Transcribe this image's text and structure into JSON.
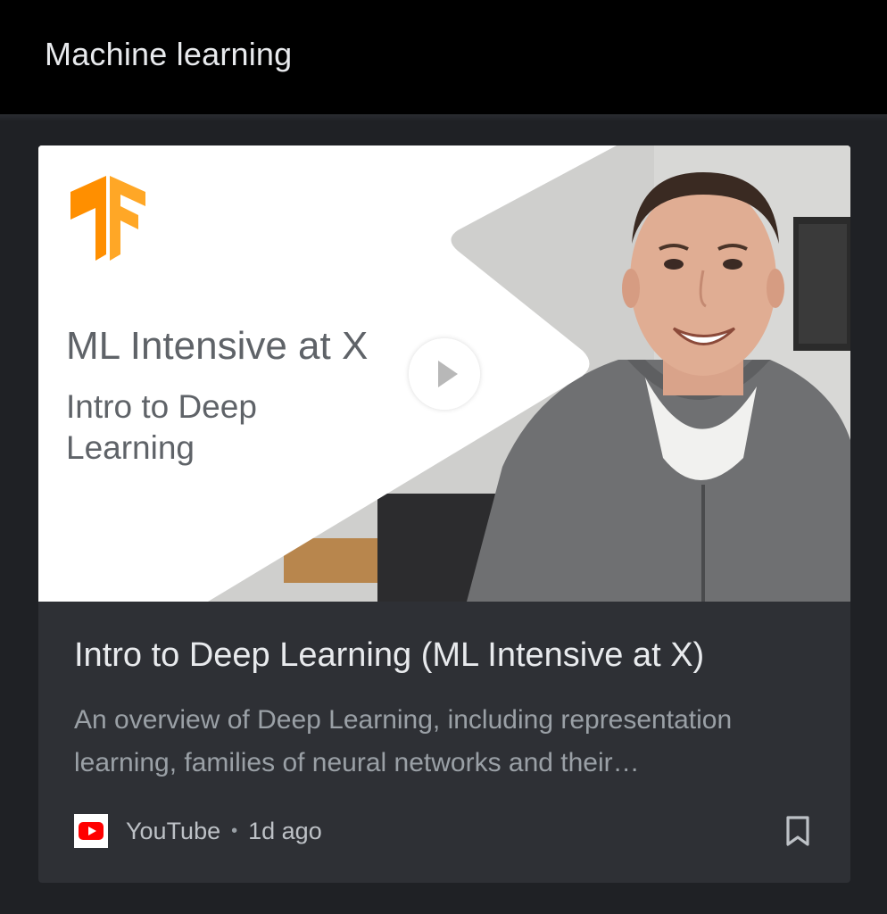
{
  "header": {
    "title": "Machine learning"
  },
  "card": {
    "thumbnail": {
      "title": "ML Intensive at X",
      "subtitle": "Intro to Deep Learning",
      "logo_icon": "tensorflow-logo",
      "play_icon": "play-icon"
    },
    "title": "Intro to Deep Learning (ML Intensive at X)",
    "description": "An overview of Deep Learning, including representation learning, families of neural networks and their…",
    "source": {
      "icon": "youtube-icon",
      "name": "YouTube",
      "separator": "•",
      "time": "1d ago"
    },
    "bookmark_icon": "bookmark-icon"
  },
  "colors": {
    "header_bg": "#000000",
    "page_bg": "#1f2125",
    "card_bg": "#2e3035",
    "tensorflow_orange": "#ff8f00",
    "youtube_red": "#ff0000"
  }
}
